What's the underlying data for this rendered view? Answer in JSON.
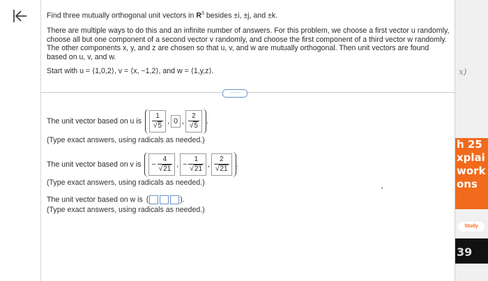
{
  "question": {
    "line1_pre": "Find three mutually orthogonal unit vectors in ",
    "R": "R",
    "R_sup": "3",
    "line1_post": " besides ±i, ±j, and ±k.",
    "para": "There are multiple ways to do this and an infinite number of answers. For this problem, we choose a first vector u randomly, choose all but one component of a second vector v randomly, and choose the first component of a third vector w randomly. The other components x, y, and z are chosen so that u, v, and w are mutually orthogonal. Then unit vectors are found based on u, v, and w.",
    "start": "Start with u = ⟨1,0,2⟩, v = ⟨x, −1,2⟩, and w = ⟨1,y,z⟩."
  },
  "more_button": "·····",
  "answers": {
    "u_label": "The unit vector based on u is",
    "u_components": [
      {
        "num": "1",
        "den": "5"
      },
      {
        "plain": "0"
      },
      {
        "num": "2",
        "den": "5"
      }
    ],
    "u_note": "(Type exact answers, using radicals as needed.)",
    "v_label": "The unit vector based on v is",
    "v_components": [
      {
        "neg": "−",
        "num": "4",
        "den": "21"
      },
      {
        "neg": "−",
        "num": "1",
        "den": "21"
      },
      {
        "num": "2",
        "den": "21"
      }
    ],
    "v_note": "(Type exact answers, using radicals as needed.)",
    "w_label": "The unit vector based on w is",
    "w_note": "(Type exact answers, using radicals as needed.)"
  },
  "right_strip": {
    "x_glyph": "x)",
    "promo_lines": [
      "h 25",
      "xplai",
      "work",
      "ons"
    ],
    "study_label": "Study",
    "badge_text": "39"
  }
}
